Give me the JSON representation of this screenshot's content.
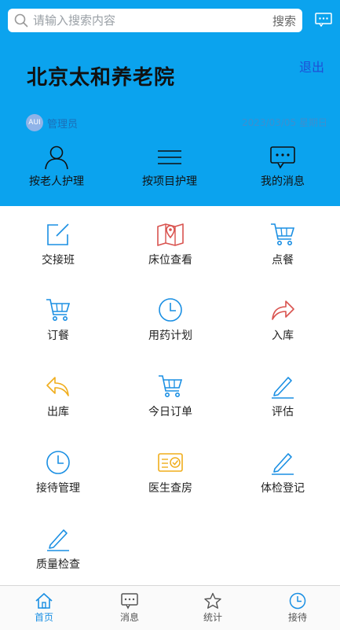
{
  "search": {
    "placeholder": "请输入搜索内容",
    "button": "搜索"
  },
  "header": {
    "title": "北京太和养老院",
    "logout": "退出",
    "avatar_text": "AUI",
    "username": "管理员",
    "date": "2023/03/05 星期日"
  },
  "top_nav": [
    {
      "label": "按老人护理",
      "icon": "person-icon"
    },
    {
      "label": "按项目护理",
      "icon": "menu-lines-icon"
    },
    {
      "label": "我的消息",
      "icon": "message-icon"
    }
  ],
  "grid": [
    {
      "label": "交接班",
      "icon": "edit-icon",
      "color": "#1a8fe3"
    },
    {
      "label": "床位查看",
      "icon": "map-icon",
      "color": "#d9534f"
    },
    {
      "label": "点餐",
      "icon": "cart-icon",
      "color": "#1a8fe3"
    },
    {
      "label": "订餐",
      "icon": "cart-icon",
      "color": "#1a8fe3"
    },
    {
      "label": "用药计划",
      "icon": "clock-icon",
      "color": "#1a8fe3"
    },
    {
      "label": "入库",
      "icon": "share-arrow-icon",
      "color": "#d9534f"
    },
    {
      "label": "出库",
      "icon": "reply-arrow-icon",
      "color": "#f0ad1c"
    },
    {
      "label": "今日订单",
      "icon": "cart-icon",
      "color": "#1a8fe3"
    },
    {
      "label": "评估",
      "icon": "pencil-icon",
      "color": "#1a8fe3"
    },
    {
      "label": "接待管理",
      "icon": "clock-icon",
      "color": "#1a8fe3"
    },
    {
      "label": "医生查房",
      "icon": "card-icon",
      "color": "#f0ad1c"
    },
    {
      "label": "体检登记",
      "icon": "pencil-icon",
      "color": "#1a8fe3"
    },
    {
      "label": "质量检查",
      "icon": "pencil-icon",
      "color": "#1a8fe3"
    }
  ],
  "tabs": [
    {
      "label": "首页",
      "icon": "home-icon",
      "active": true
    },
    {
      "label": "消息",
      "icon": "message-icon",
      "active": false
    },
    {
      "label": "统计",
      "icon": "star-icon",
      "active": false
    },
    {
      "label": "接待",
      "icon": "clock-icon",
      "active": false
    }
  ],
  "colors": {
    "header_bg": "#0ba3ee",
    "accent": "#1a8fe3",
    "red": "#d9534f",
    "yellow": "#f0ad1c"
  }
}
